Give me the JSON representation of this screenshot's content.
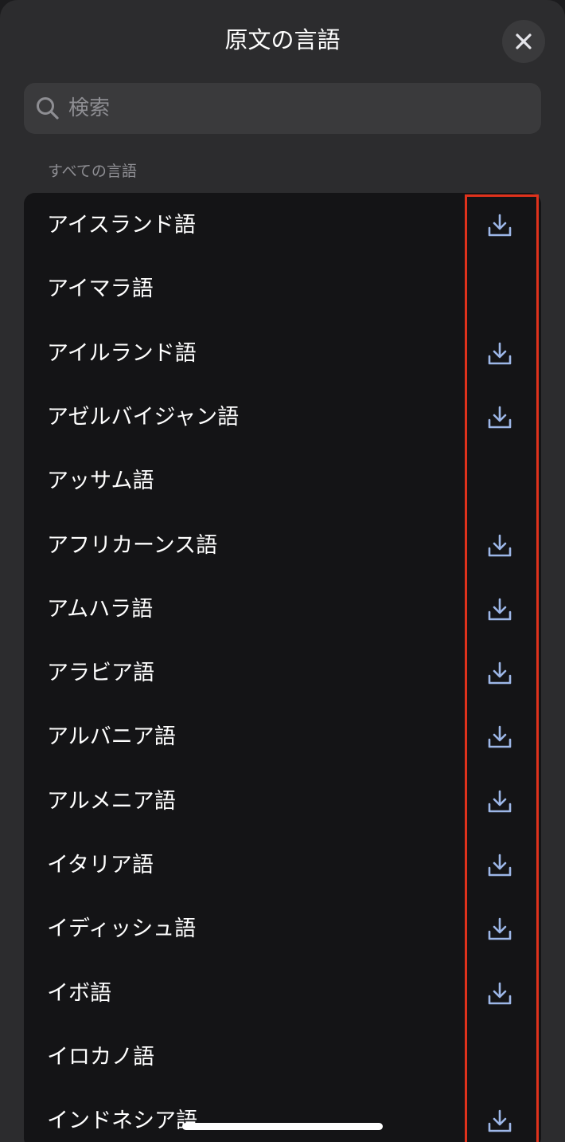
{
  "header": {
    "title": "原文の言語",
    "close_icon": "close-icon"
  },
  "search": {
    "placeholder": "検索",
    "value": "",
    "icon": "search-icon"
  },
  "section": {
    "label": "すべての言語"
  },
  "languages": [
    {
      "label": "アイスランド語",
      "downloadable": true
    },
    {
      "label": "アイマラ語",
      "downloadable": false
    },
    {
      "label": "アイルランド語",
      "downloadable": true
    },
    {
      "label": "アゼルバイジャン語",
      "downloadable": true
    },
    {
      "label": "アッサム語",
      "downloadable": false
    },
    {
      "label": "アフリカーンス語",
      "downloadable": true
    },
    {
      "label": "アムハラ語",
      "downloadable": true
    },
    {
      "label": "アラビア語",
      "downloadable": true
    },
    {
      "label": "アルバニア語",
      "downloadable": true
    },
    {
      "label": "アルメニア語",
      "downloadable": true
    },
    {
      "label": "イタリア語",
      "downloadable": true
    },
    {
      "label": "イディッシュ語",
      "downloadable": true
    },
    {
      "label": "イボ語",
      "downloadable": true
    },
    {
      "label": "イロカノ語",
      "downloadable": false
    },
    {
      "label": "インドネシア語",
      "downloadable": true
    }
  ],
  "colors": {
    "download_icon": "#9db7e8",
    "highlight_box": "#e0321c"
  }
}
